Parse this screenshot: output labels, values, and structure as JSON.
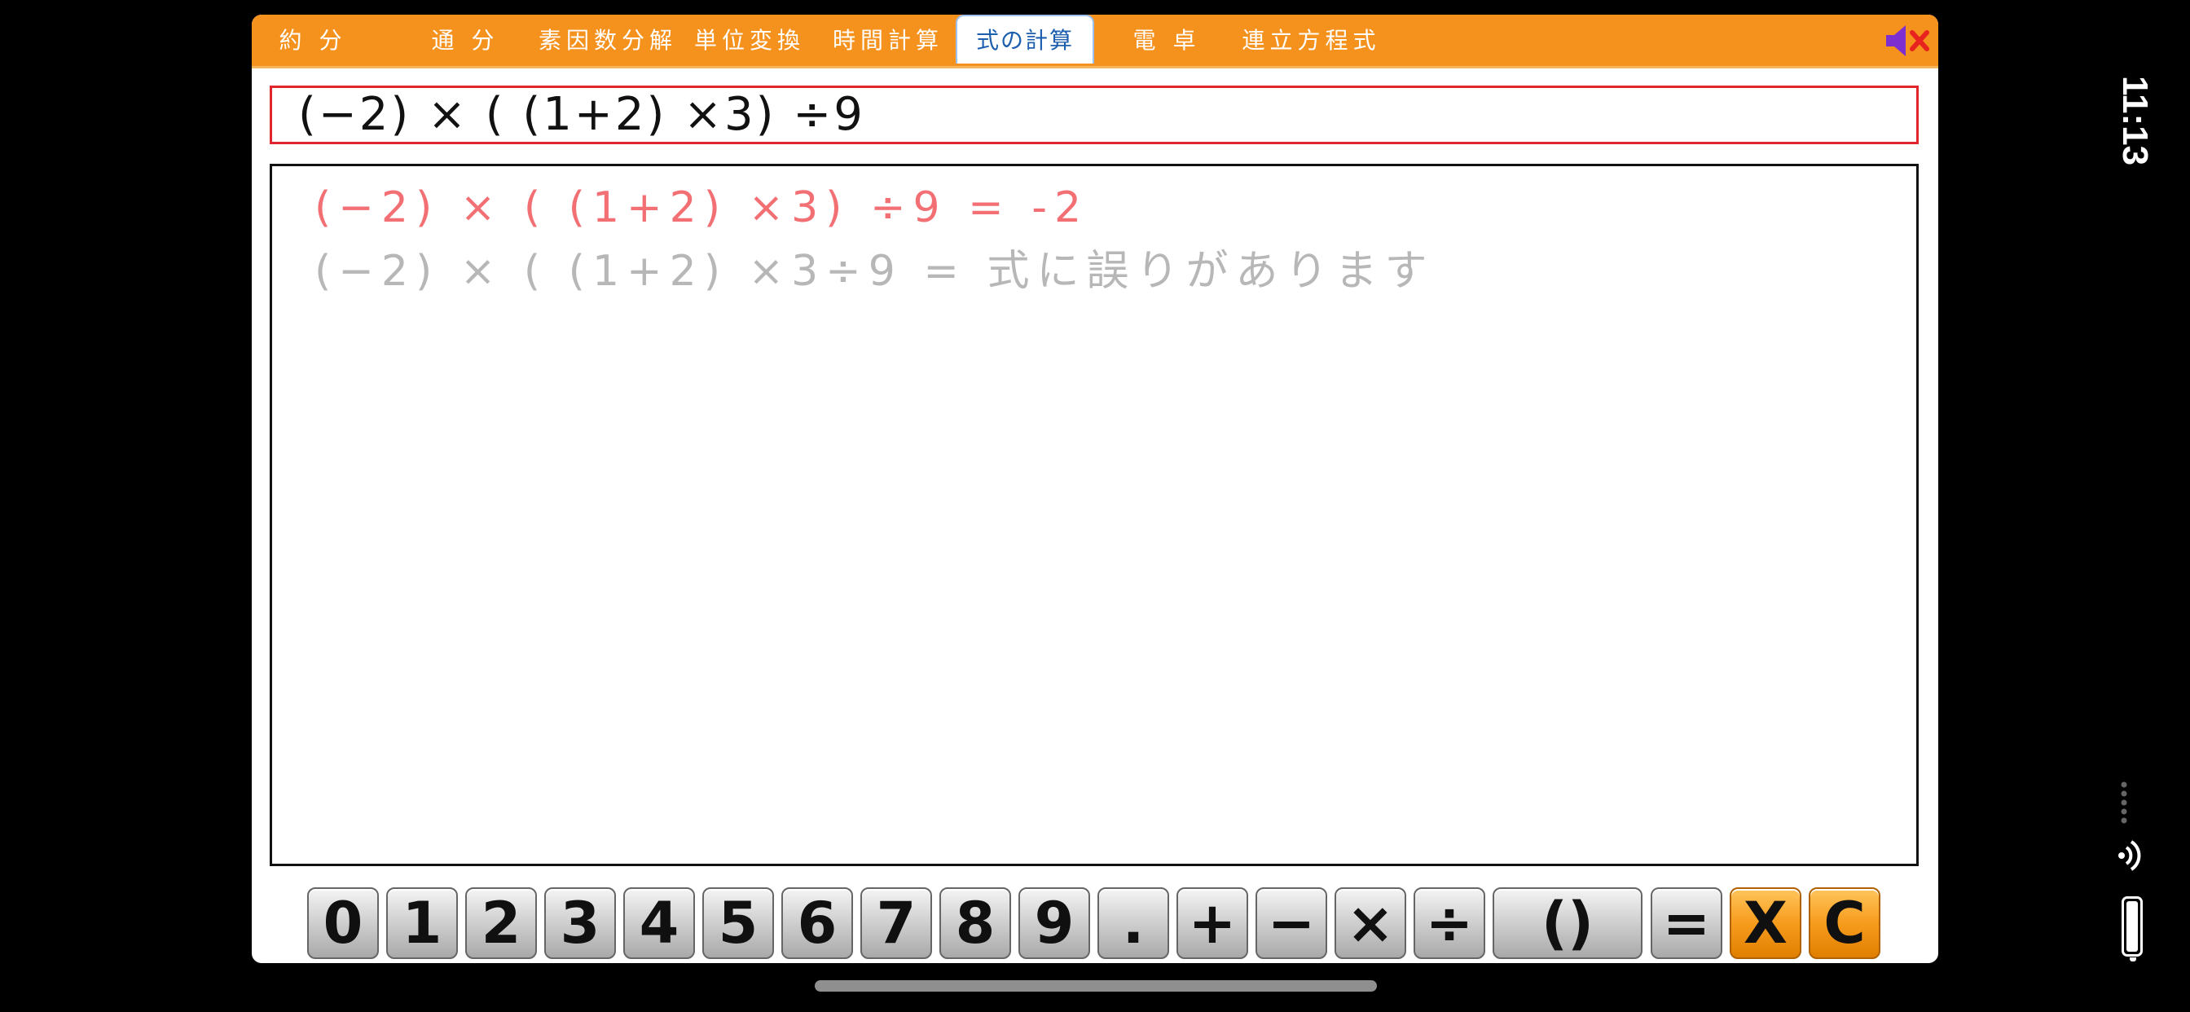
{
  "tabs": [
    {
      "id": "yakubun",
      "label": "約 分"
    },
    {
      "id": "tsubun",
      "label": "通 分"
    },
    {
      "id": "soinsu",
      "label": "素因数分解"
    },
    {
      "id": "tani",
      "label": "単位変換"
    },
    {
      "id": "jikan",
      "label": "時間計算"
    },
    {
      "id": "shiki",
      "label": "式の計算",
      "active": true
    },
    {
      "id": "dentaku",
      "label": "電 卓"
    },
    {
      "id": "renritsu",
      "label": "連立方程式"
    }
  ],
  "sound_icon": "speaker-muted-icon",
  "input": {
    "expression": "(−2) × ( (1+2) ×3) ÷9"
  },
  "output": {
    "lines": [
      {
        "text": "(−2) × ( (1+2) ×3) ÷9 = -2",
        "color": "#f26f74"
      },
      {
        "text": "(−2) × ( (1+2) ×3÷9 = 式に誤りがあります",
        "color": "#b7b7b7"
      }
    ]
  },
  "keypad": {
    "keys": [
      "0",
      "1",
      "2",
      "3",
      "4",
      "5",
      "6",
      "7",
      "8",
      "9",
      ".",
      "+",
      "−",
      "×",
      "÷",
      "()",
      "=",
      "X",
      "C"
    ]
  },
  "status_bar": {
    "time": "11:13"
  },
  "colors": {
    "accent": "#f5921e",
    "input_border": "#e0262c",
    "result_red": "#f26f74",
    "error_gray": "#b7b7b7"
  }
}
